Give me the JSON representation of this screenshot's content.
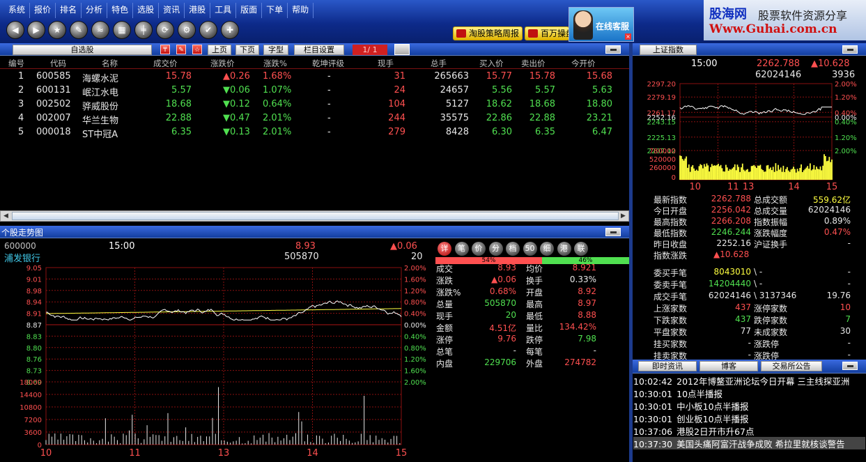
{
  "menu": [
    "系统",
    "报价",
    "排名",
    "分析",
    "特色",
    "选股",
    "资讯",
    "港股",
    "工具",
    "版面",
    "下单",
    "帮助"
  ],
  "toolbar_icons": [
    "back-icon",
    "forward-icon",
    "star-icon",
    "pen-icon",
    "chart-icon",
    "grid-icon",
    "candle-icon",
    "refresh-icon",
    "settings-icon",
    "tool-icon",
    "pin-icon"
  ],
  "promo": {
    "tao": "淘股策略周报",
    "bai": "百万操盘",
    "kefu": "在线客服"
  },
  "logo": {
    "name": "股海网",
    "slogan": "股票软件资源分享",
    "url": "Www.Guhai.com.cn"
  },
  "watchlist": {
    "title": "自选股",
    "prev": "上页",
    "next": "下页",
    "font": "字型",
    "cols": "栏目设置",
    "page": "1/ 1",
    "headers": [
      "编号",
      "代码",
      "名称",
      "成交价",
      "涨跌价",
      "涨跌%",
      "乾坤评级",
      "现手",
      "总手",
      "买入价",
      "卖出价",
      "今开价"
    ],
    "rows": [
      {
        "no": "1",
        "code": "600585",
        "name": "海螺水泥",
        "price": "15.78",
        "chg": "0.26",
        "dir": "up",
        "pct": "1.68%",
        "rating": "-",
        "now": "31",
        "total": "265663",
        "buy": "15.77",
        "sell": "15.78",
        "open": "15.68"
      },
      {
        "no": "2",
        "code": "600131",
        "name": "岷江水电",
        "price": "5.57",
        "chg": "0.06",
        "dir": "down",
        "pct": "1.07%",
        "rating": "-",
        "now": "24",
        "total": "24657",
        "buy": "5.56",
        "sell": "5.57",
        "open": "5.63"
      },
      {
        "no": "3",
        "code": "002502",
        "name": "骅威股份",
        "price": "18.68",
        "chg": "0.12",
        "dir": "down",
        "pct": "0.64%",
        "rating": "-",
        "now": "104",
        "total": "5127",
        "buy": "18.62",
        "sell": "18.68",
        "open": "18.80"
      },
      {
        "no": "4",
        "code": "002007",
        "name": "华兰生物",
        "price": "22.88",
        "chg": "0.47",
        "dir": "down",
        "pct": "2.01%",
        "rating": "-",
        "now": "244",
        "total": "35575",
        "buy": "22.86",
        "sell": "22.88",
        "open": "23.21"
      },
      {
        "no": "5",
        "code": "000018",
        "name": "ST中冠A",
        "price": "6.35",
        "chg": "0.13",
        "dir": "down",
        "pct": "2.01%",
        "rating": "-",
        "now": "279",
        "total": "8428",
        "buy": "6.30",
        "sell": "6.35",
        "open": "6.47"
      }
    ]
  },
  "stock_chart": {
    "panel_title": "个股走势图",
    "code": "600000",
    "name": "浦发银行",
    "time": "15:00",
    "price": "8.93",
    "change": "0.06",
    "volume": "505870",
    "last_hand": "20",
    "y_left": [
      "9.05",
      "9.01",
      "8.98",
      "8.94",
      "8.91",
      "8.87",
      "8.83",
      "8.80",
      "8.76",
      "8.73",
      "8.69"
    ],
    "y_right": [
      "2.00%",
      "1.60%",
      "1.20%",
      "0.80%",
      "0.40%",
      "0.00%",
      "0.40%",
      "0.80%",
      "1.20%",
      "1.60%",
      "2.00%"
    ],
    "vol_axis": [
      "18000",
      "14400",
      "10800",
      "7200",
      "3600",
      "0"
    ],
    "x_ticks": [
      "10",
      "11",
      "13",
      "14",
      "15"
    ]
  },
  "detail": {
    "buttons": [
      "详",
      "笔",
      "价",
      "分",
      "档",
      "50",
      "细",
      "港",
      "联"
    ],
    "ratio_left": "54%",
    "ratio_right": "46%",
    "rows": [
      [
        "成交",
        "8.93",
        "均价",
        "8.921"
      ],
      [
        "涨跌",
        "0.06",
        "换手",
        "0.33%"
      ],
      [
        "涨跌%",
        "0.68%",
        "开盘",
        "8.92"
      ],
      [
        "总量",
        "505870",
        "最高",
        "8.97"
      ],
      [
        "现手",
        "20",
        "最低",
        "8.88"
      ],
      [
        "金额",
        "4.51亿",
        "量比",
        "134.42%"
      ],
      [
        "涨停",
        "9.76",
        "跌停",
        "7.98"
      ],
      [
        "总笔",
        "-",
        "每笔",
        "-"
      ],
      [
        "内盘",
        "229706",
        "外盘",
        "274782"
      ]
    ]
  },
  "index": {
    "title": "上证指数",
    "time": "15:00",
    "value": "2262.788",
    "change": "10.628",
    "volume": "62024146",
    "hand": "3936",
    "y_left": [
      "2297.20",
      "2279.19",
      "2261.17",
      "2252.16",
      "2243.15",
      "2225.13",
      "2207.12"
    ],
    "y_right": [
      "2.00%",
      "1.20%",
      "0.40%",
      "0.00%",
      "0.40%",
      "1.20%",
      "2.00%"
    ],
    "vol_axis": [
      "780000",
      "520000",
      "260000",
      "0"
    ],
    "x_ticks": [
      "10",
      "11",
      "13",
      "14",
      "15"
    ],
    "stats": [
      [
        "最新指数",
        "2262.788",
        "总成交额",
        "559.62亿"
      ],
      [
        "今日开盘",
        "2256.042",
        "总成交量",
        "62024146"
      ],
      [
        "最高指数",
        "2266.208",
        "指数振幅",
        "0.89%"
      ],
      [
        "最低指数",
        "2246.244",
        "涨跌幅度",
        "0.47%"
      ],
      [
        "昨日收盘",
        "2252.16",
        "沪证换手",
        "-"
      ],
      [
        "指数涨跌",
        "10.628",
        "",
        ""
      ]
    ],
    "stats2": [
      [
        "委买手笔",
        "8043010",
        "\\ -",
        "-"
      ],
      [
        "委卖手笔",
        "14204440",
        "\\ -",
        "-"
      ],
      [
        "成交手笔",
        "62024146",
        "\\ 3137346",
        "19.76"
      ],
      [
        "上涨家数",
        "437",
        "涨停家数",
        "10"
      ],
      [
        "下跌家数",
        "437",
        "跌停家数",
        "7"
      ],
      [
        "平盘家数",
        "77",
        "未成家数",
        "30"
      ],
      [
        "挂买家数",
        "-",
        "涨跌停",
        "-"
      ],
      [
        "挂卖家数",
        "-",
        "涨跌停",
        "-"
      ]
    ]
  },
  "news": {
    "tabs": [
      "即时资讯",
      "博客",
      "交易所公告"
    ],
    "items": [
      {
        "time": "10:02:42",
        "text": "2012年博鳌亚洲论坛今日开幕 三主线探亚洲"
      },
      {
        "time": "10:30:01",
        "text": "10点半播报"
      },
      {
        "time": "10:30:01",
        "text": "中小板10点半播报"
      },
      {
        "time": "10:30:01",
        "text": "创业板10点半播报"
      },
      {
        "time": "10:37:06",
        "text": "港股2日开市升67点"
      },
      {
        "time": "10:37:30",
        "text": "美国头痛阿富汗战争成败 希拉里就核谈警告"
      }
    ]
  },
  "colors": {
    "up": "#ff5050",
    "down": "#50e050",
    "grid": "#8a1010",
    "line": "#ffffff",
    "avg": "#ffff40"
  }
}
